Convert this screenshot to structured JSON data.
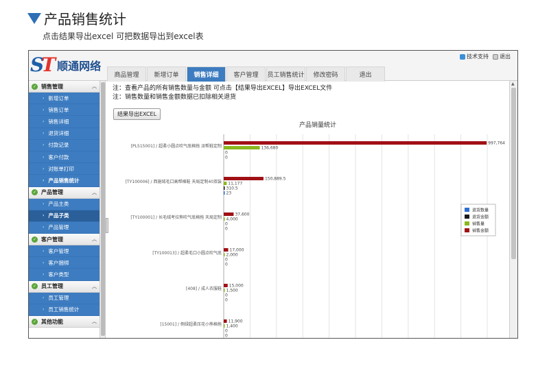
{
  "page": {
    "title": "产品销售统计",
    "subtitle": "点击结果导出excel 可把数据导出到excel表"
  },
  "app": {
    "logo_mark_a": "S",
    "logo_mark_b": "T",
    "logo_text": "顺通网络",
    "help_link": "技术支持",
    "exit_link": "退出",
    "tabs": [
      {
        "label": "商品管理"
      },
      {
        "label": "新增订单"
      },
      {
        "label": "销售详细",
        "active": true
      },
      {
        "label": "客户管理"
      },
      {
        "label": "员工销售统计"
      },
      {
        "label": "修改密码"
      },
      {
        "label": "退出"
      }
    ]
  },
  "sidebar": {
    "groups": [
      {
        "label": "销售管理",
        "items": [
          "新增订单",
          "销售订单",
          "销售详细",
          "退货详细",
          "付款记录",
          "客户付款",
          "对账单打印",
          "产品销售统计"
        ]
      },
      {
        "label": "产品管理",
        "items": [
          "产品主类",
          "产品子类",
          "产品管理"
        ]
      },
      {
        "label": "客户管理",
        "items": [
          "客户管理",
          "客户捆绑",
          "客户类型"
        ]
      },
      {
        "label": "员工管理",
        "items": [
          "员工管理",
          "员工销售统计"
        ]
      },
      {
        "label": "其他功能",
        "items": []
      }
    ]
  },
  "main": {
    "note_line1": "注：查看产品的所有销售数量与金额 可点击【结果导出EXCEL】导出EXCEL文件",
    "note_line2": "注：销售数量和销售金额数据已扣除相关退货",
    "export_button": "结果导出EXCEL"
  },
  "colors": {
    "退货数量": "#2e6fd0",
    "退货金额": "#1a1a1a",
    "销售量": "#8ab81e",
    "销售金额": "#a01015"
  },
  "chart_data": {
    "type": "bar",
    "orientation": "horizontal",
    "title": "产品销量统计",
    "legend_position": "right",
    "grid": true,
    "xlim": [
      0,
      1000000
    ],
    "categories": [
      "[PL515001] / 超柔小圆点吹气底棉拖 派帮鞋定制",
      "[TY100006] / 西施绒毛口高帮棉鞋 天局定制40双装",
      "[TY100001] / 长毛绒考拉熊吹气底棉拖 天局定制",
      "[TY100013] / 超柔毛口小圆点吹气底",
      "[408] / 成人衣服鞋",
      "[15001] / 侧绿超柔压花小熊棉拖"
    ],
    "series": [
      {
        "name": "销售金额",
        "values": [
          997764,
          150889.5,
          37600,
          17000,
          15000,
          11900
        ],
        "labels": [
          "997,764",
          "150,889.5",
          "37,600",
          "17,000",
          "15,000",
          "11,900"
        ]
      },
      {
        "name": "销售量",
        "values": [
          136680,
          11177,
          4000,
          2000,
          1500,
          1400
        ],
        "labels": [
          "136,680",
          "11,177",
          "4,000",
          "2,000",
          "1,500",
          "1,400"
        ]
      },
      {
        "name": "退货金额",
        "values": [
          0,
          310.5,
          0,
          0,
          0,
          0
        ],
        "labels": [
          "0",
          "310.5",
          "0",
          "0",
          "0",
          "0"
        ]
      },
      {
        "name": "退货数量",
        "values": [
          0,
          23,
          0,
          0,
          0,
          0
        ],
        "labels": [
          "0",
          "23",
          "0",
          "0",
          "0",
          "0"
        ]
      }
    ],
    "legend": [
      "退货数量",
      "退货金额",
      "销售量",
      "销售金额"
    ]
  }
}
